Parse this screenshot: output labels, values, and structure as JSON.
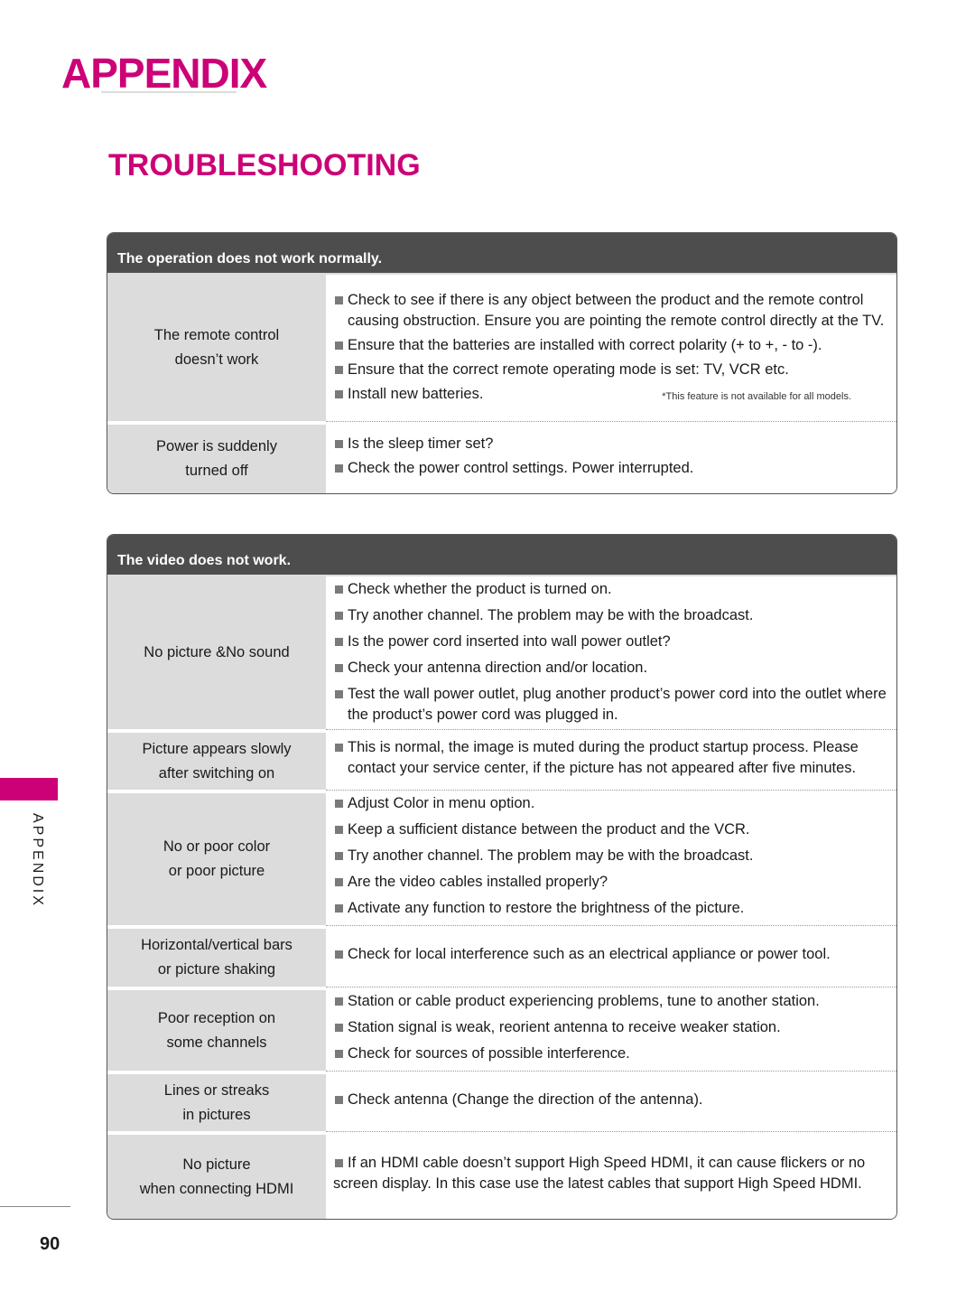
{
  "page": {
    "chapter_title": "APPENDIX",
    "section_title": "TROUBLESHOOTING",
    "side_tab_label": "APPENDIX",
    "page_number": "90",
    "accent_color": "#cc0077"
  },
  "tables": [
    {
      "header": "The operation does not work normally.",
      "rows": [
        {
          "problem": "The remote control\ndoesn’t work",
          "solutions": [
            "Check to see if there is any object between the product and the remote control causing obstruction. Ensure you are pointing the remote control directly at the TV.",
            "Ensure that the batteries are installed with correct polarity (+ to +, - to -).",
            "Ensure that the correct remote operating mode is set: TV, VCR etc.",
            "Install new batteries."
          ],
          "note": "*This feature is not available for all models."
        },
        {
          "problem": "Power is suddenly\nturned off",
          "solutions": [
            "Is the sleep timer set?",
            "Check the power control settings. Power interrupted."
          ]
        }
      ]
    },
    {
      "header": "The video does not work.",
      "rows": [
        {
          "problem": "No picture &No sound",
          "solutions": [
            "Check whether the product is turned on.",
            "Try another channel. The problem may be with the broadcast.",
            "Is the power cord inserted into wall power outlet?",
            "Check your antenna direction and/or location.",
            "Test the wall power outlet, plug another product’s power cord into the outlet where the product’s power cord was plugged in."
          ]
        },
        {
          "problem": "Picture appears slowly\nafter switching on",
          "solutions": [
            "This is normal, the image is muted during the product startup process. Please contact your service center, if the picture has not appeared after five minutes."
          ]
        },
        {
          "problem": "No or poor color\nor poor picture",
          "solutions": [
            "Adjust Color in menu option.",
            "Keep a sufficient distance between the product and the VCR.",
            "Try another channel. The problem may be with the broadcast.",
            "Are the video cables installed properly?",
            "Activate any function to restore the brightness of the picture."
          ]
        },
        {
          "problem": "Horizontal/vertical bars\nor picture shaking",
          "solutions": [
            "Check for local interference such as an electrical appliance or power tool."
          ]
        },
        {
          "problem": "Poor reception on\nsome channels",
          "solutions": [
            "Station or cable product experiencing problems, tune to another station.",
            "Station signal is weak, reorient antenna to receive weaker station.",
            "Check for sources of possible interference."
          ]
        },
        {
          "problem": "Lines or streaks\nin pictures",
          "solutions": [
            "Check antenna (Change the direction of the antenna)."
          ]
        },
        {
          "problem": "No picture\nwhen connecting HDMI",
          "solutions": [
            "If an HDMI cable doesn’t support High Speed HDMI, it can cause flickers or no screen display. In this case use the latest cables that support High Speed HDMI."
          ]
        }
      ]
    }
  ]
}
